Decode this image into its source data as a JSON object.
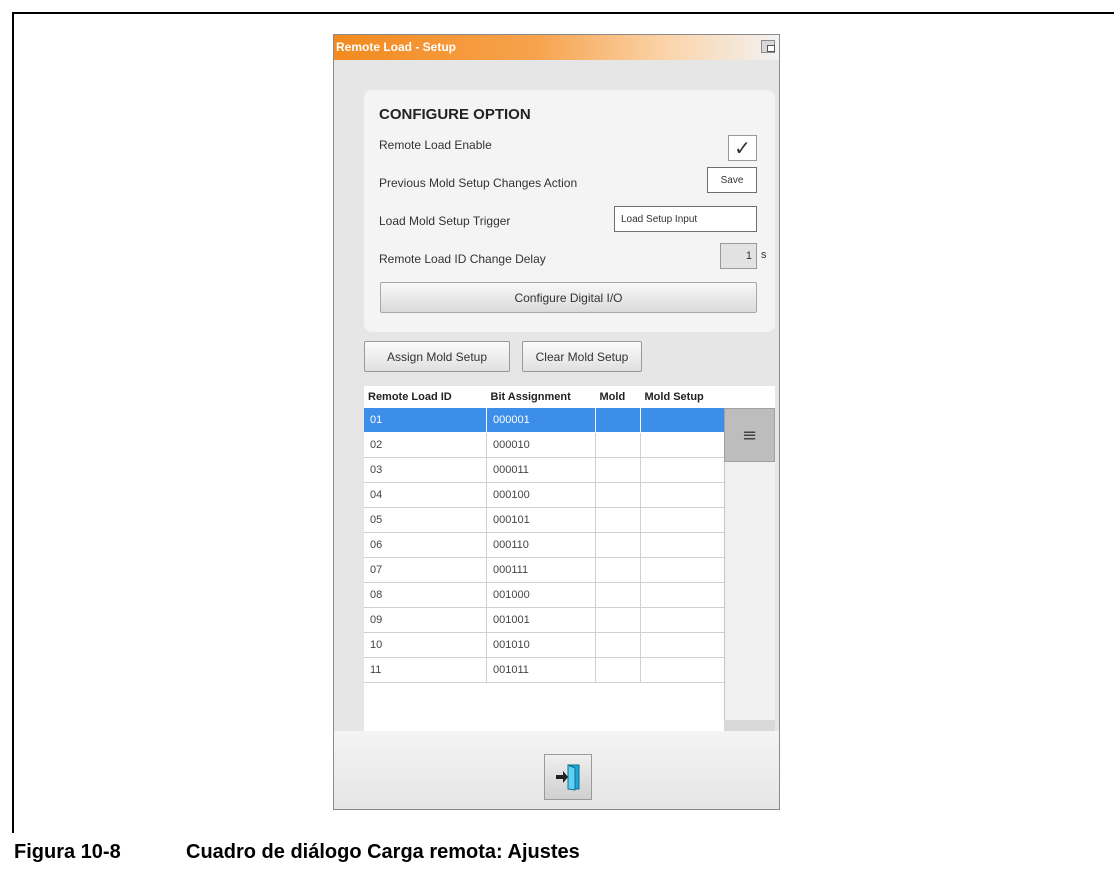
{
  "window": {
    "title": "Remote Load - Setup"
  },
  "configure": {
    "title": "CONFIGURE OPTION",
    "remote_load_enable_label": "Remote Load Enable",
    "remote_load_enable_checked": true,
    "check_glyph": "✓",
    "prev_changes_label": "Previous Mold Setup Changes Action",
    "prev_changes_value": "Save",
    "trigger_label": "Load Mold Setup Trigger",
    "trigger_value": "Load Setup Input",
    "delay_label": "Remote Load ID Change Delay",
    "delay_value": "1",
    "delay_unit": "s",
    "configure_io_button": "Configure Digital I/O"
  },
  "actions": {
    "assign_button": "Assign Mold Setup",
    "clear_button": "Clear Mold Setup"
  },
  "table": {
    "headers": [
      "Remote Load ID",
      "Bit Assignment",
      "Mold",
      "Mold Setup"
    ],
    "selected_index": 0,
    "rows": [
      {
        "id": "01",
        "bits": "000001",
        "mold": "",
        "setup": ""
      },
      {
        "id": "02",
        "bits": "000010",
        "mold": "",
        "setup": ""
      },
      {
        "id": "03",
        "bits": "000011",
        "mold": "",
        "setup": ""
      },
      {
        "id": "04",
        "bits": "000100",
        "mold": "",
        "setup": ""
      },
      {
        "id": "05",
        "bits": "000101",
        "mold": "",
        "setup": ""
      },
      {
        "id": "06",
        "bits": "000110",
        "mold": "",
        "setup": ""
      },
      {
        "id": "07",
        "bits": "000111",
        "mold": "",
        "setup": ""
      },
      {
        "id": "08",
        "bits": "001000",
        "mold": "",
        "setup": ""
      },
      {
        "id": "09",
        "bits": "001001",
        "mold": "",
        "setup": ""
      },
      {
        "id": "10",
        "bits": "001010",
        "mold": "",
        "setup": ""
      },
      {
        "id": "11",
        "bits": "001011",
        "mold": "",
        "setup": ""
      }
    ],
    "scroll_glyph": "≡"
  },
  "footer": {
    "exit_icon": "exit-door-icon"
  },
  "caption": {
    "figure": "Figura 10-8",
    "text": "Cuadro de diálogo Carga remota: Ajustes"
  },
  "colors": {
    "title_gradient_start": "#f28a1f",
    "selection": "#3d8ee8",
    "exit_door": "#1aa7d9"
  }
}
